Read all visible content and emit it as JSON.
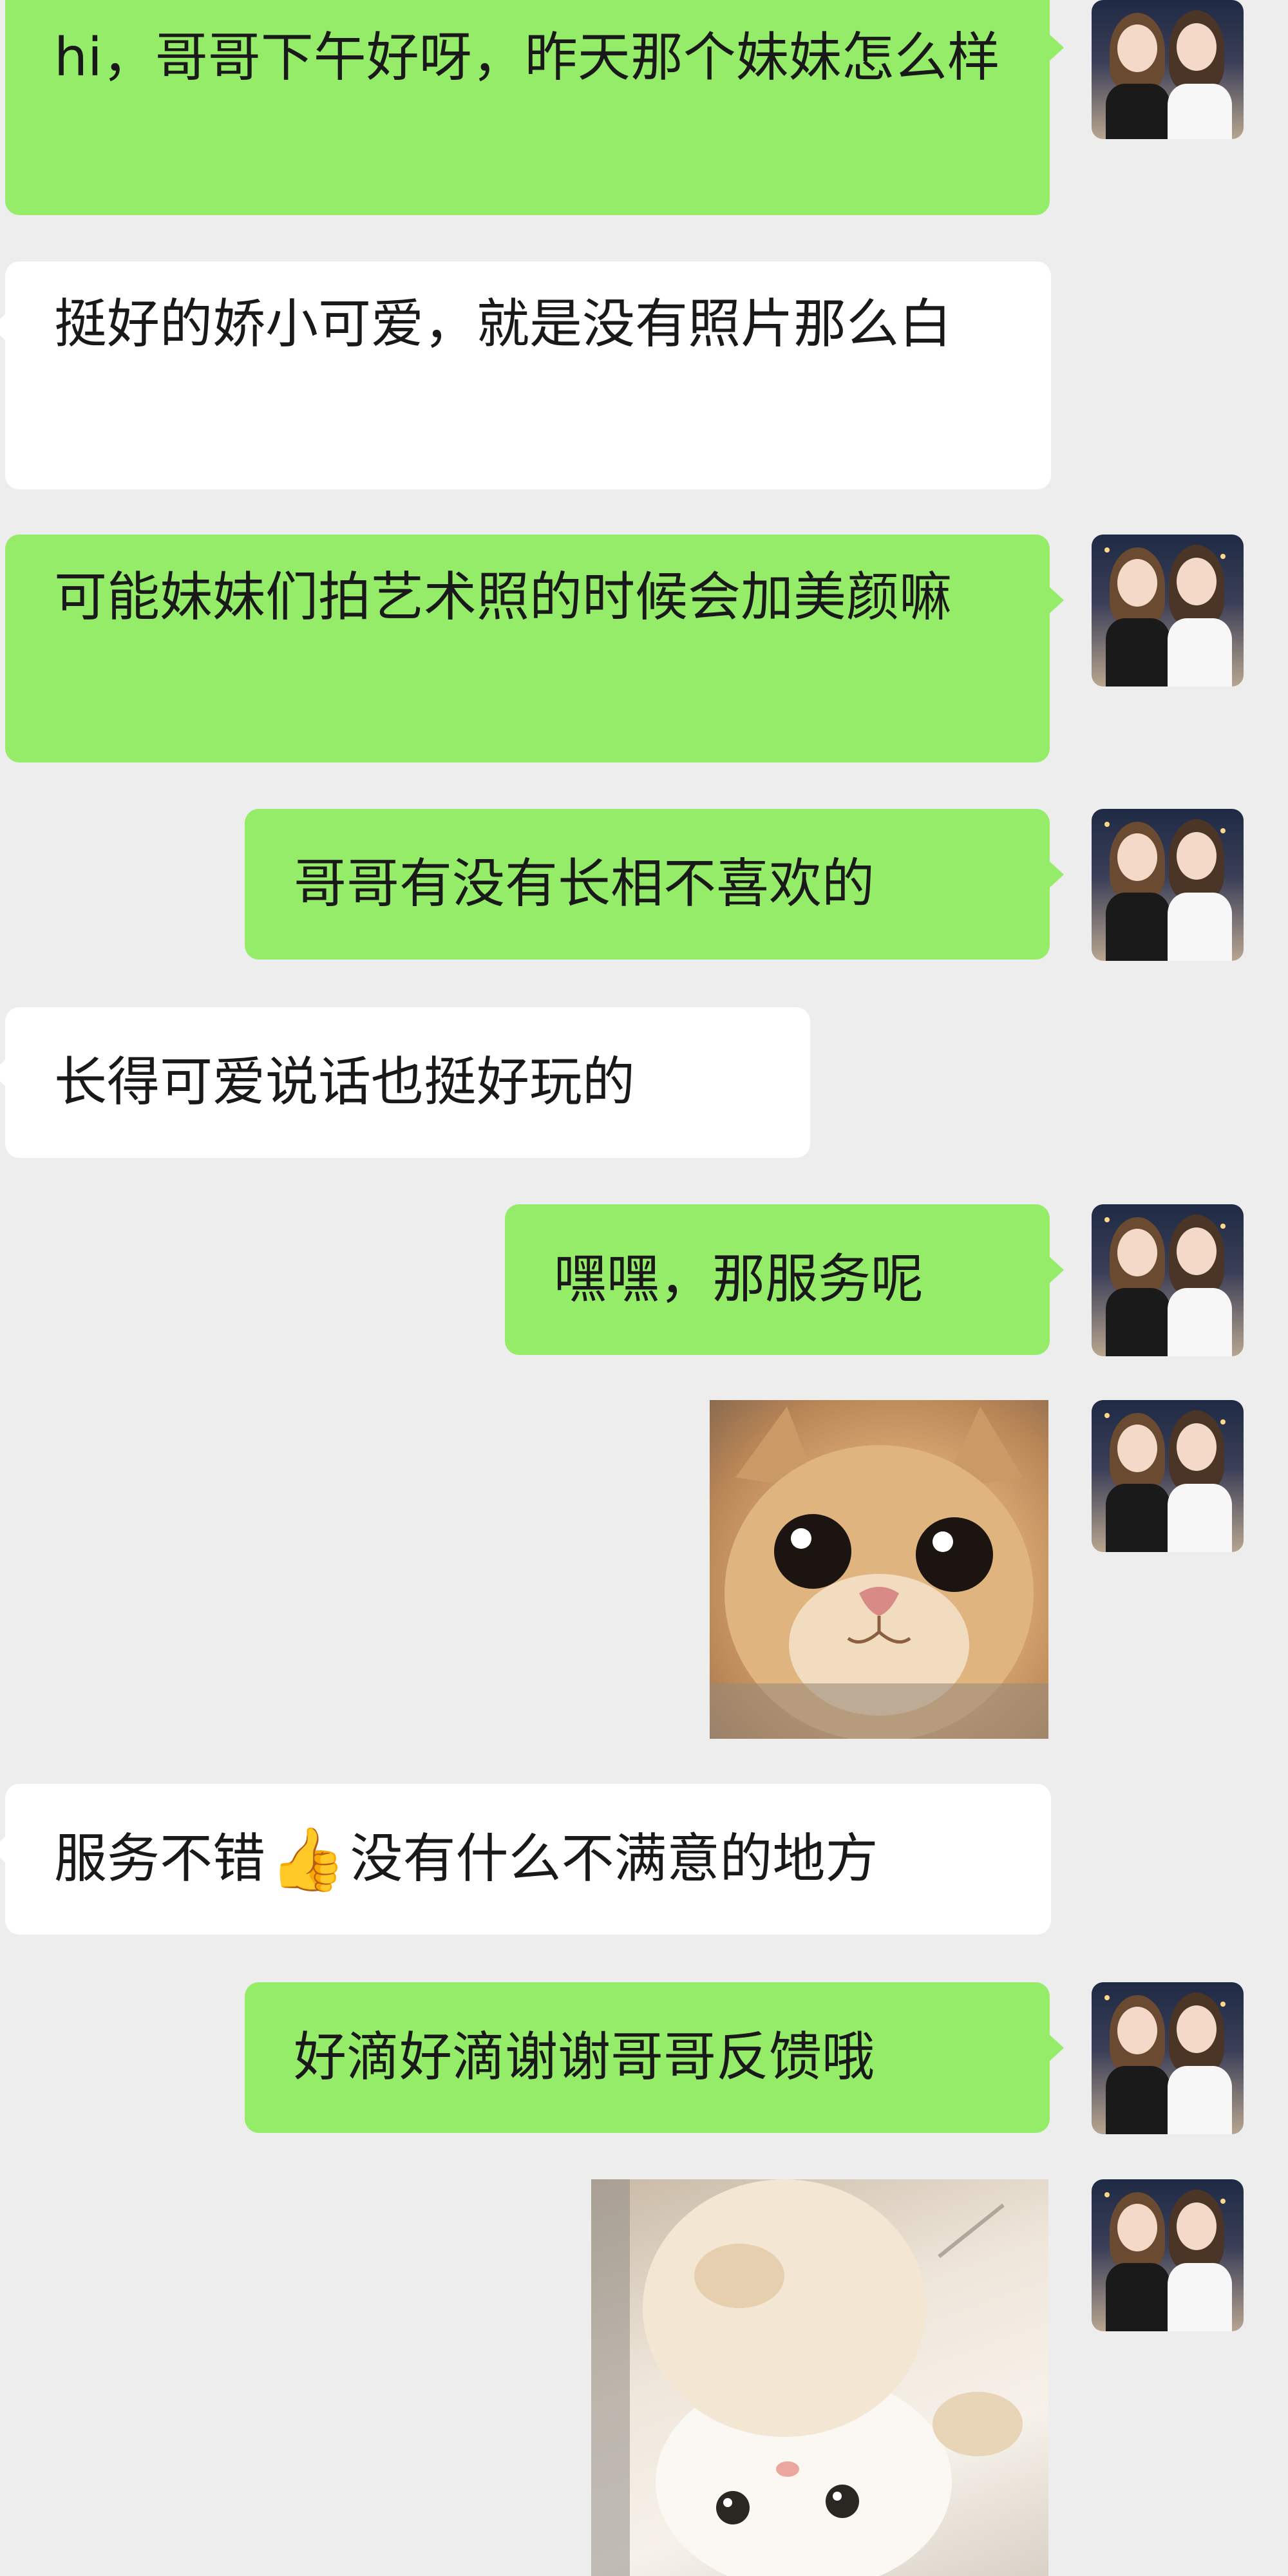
{
  "messages": [
    {
      "from": "me",
      "text": "hi，哥哥下午好呀，昨天那个妹妹怎么样"
    },
    {
      "from": "other",
      "text": "挺好的娇小可爱，就是没有照片那么白"
    },
    {
      "from": "me",
      "text": "可能妹妹们拍艺术照的时候会加美颜嘛"
    },
    {
      "from": "me",
      "text": "哥哥有没有长相不喜欢的"
    },
    {
      "from": "other",
      "text": "长得可爱说话也挺好玩的"
    },
    {
      "from": "me",
      "text": "嘿嘿，那服务呢"
    },
    {
      "from": "me",
      "sticker": "orange-kitten-closeup"
    },
    {
      "from": "other",
      "text_before": "服务不错",
      "emoji": "👍",
      "text_after": "没有什么不满意的地方"
    },
    {
      "from": "me",
      "text": "好滴好滴谢谢哥哥反馈哦"
    },
    {
      "from": "me",
      "sticker": "white-kitten-upside-down"
    }
  ],
  "colors": {
    "background": "#ededed",
    "my_bubble": "#95ec69",
    "their_bubble": "#ffffff",
    "text": "#191919"
  },
  "avatar_icon": "two-girls-avatar-icon"
}
